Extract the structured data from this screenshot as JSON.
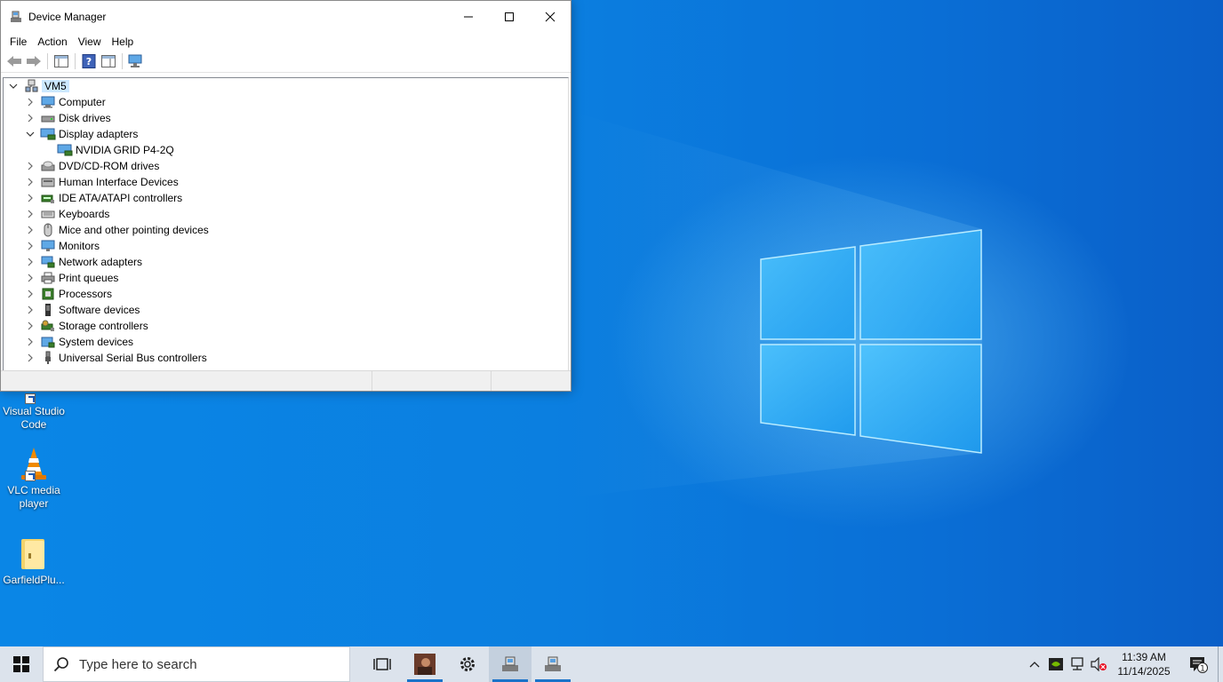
{
  "window": {
    "title": "Device Manager",
    "menu": [
      "File",
      "Action",
      "View",
      "Help"
    ]
  },
  "tree": {
    "root": "VM5",
    "items": [
      {
        "label": "Computer",
        "expanded": false,
        "icon": "computer-icon"
      },
      {
        "label": "Disk drives",
        "expanded": false,
        "icon": "disk-drive-icon"
      },
      {
        "label": "Display adapters",
        "expanded": true,
        "icon": "display-adapter-icon"
      },
      {
        "label": "NVIDIA GRID P4-2Q",
        "child": true,
        "icon": "display-adapter-icon"
      },
      {
        "label": "DVD/CD-ROM drives",
        "expanded": false,
        "icon": "dvd-drive-icon"
      },
      {
        "label": "Human Interface Devices",
        "expanded": false,
        "icon": "hid-icon"
      },
      {
        "label": "IDE ATA/ATAPI controllers",
        "expanded": false,
        "icon": "ide-controller-icon"
      },
      {
        "label": "Keyboards",
        "expanded": false,
        "icon": "keyboard-icon"
      },
      {
        "label": "Mice and other pointing devices",
        "expanded": false,
        "icon": "mouse-icon"
      },
      {
        "label": "Monitors",
        "expanded": false,
        "icon": "monitor-icon"
      },
      {
        "label": "Network adapters",
        "expanded": false,
        "icon": "network-adapter-icon"
      },
      {
        "label": "Print queues",
        "expanded": false,
        "icon": "printer-icon"
      },
      {
        "label": "Processors",
        "expanded": false,
        "icon": "processor-icon"
      },
      {
        "label": "Software devices",
        "expanded": false,
        "icon": "software-device-icon"
      },
      {
        "label": "Storage controllers",
        "expanded": false,
        "icon": "storage-controller-icon"
      },
      {
        "label": "System devices",
        "expanded": false,
        "icon": "system-device-icon"
      },
      {
        "label": "Universal Serial Bus controllers",
        "expanded": false,
        "icon": "usb-icon"
      }
    ]
  },
  "desktop_icons": [
    {
      "label": "Visual Studio Code",
      "icon": "vscode-icon"
    },
    {
      "label": "VLC media player",
      "icon": "vlc-icon"
    },
    {
      "label": "GarfieldPlu...",
      "icon": "folder-icon"
    }
  ],
  "taskbar": {
    "search_placeholder": "Type here to search",
    "apps": [
      "task-view-icon",
      "photo-app-icon",
      "settings-icon",
      "device-manager-icon",
      "device-manager-icon"
    ],
    "clock_time": "11:39 AM",
    "clock_date": "11/14/2025",
    "notification_count": "1"
  },
  "colors": {
    "desktop_blue": "#0a7fe0",
    "selection": "#cce8ff",
    "taskbar": "#dce3ec",
    "accent": "#1a73c9"
  }
}
